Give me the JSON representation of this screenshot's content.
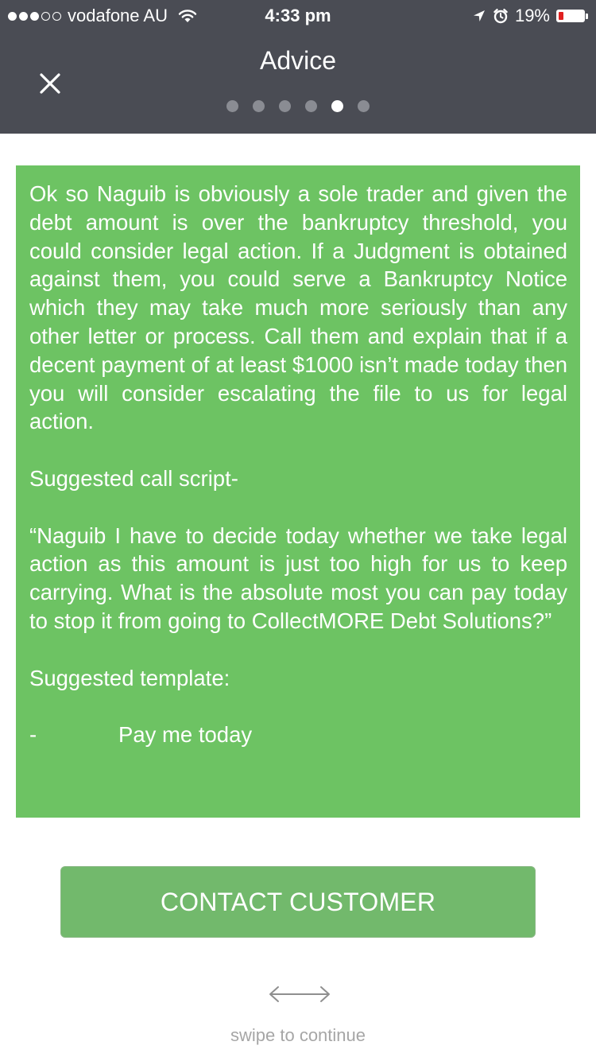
{
  "status_bar": {
    "carrier": "vodafone AU",
    "time": "4:33 pm",
    "battery_percent": "19%",
    "battery_level": 0.19,
    "signal_bars": {
      "filled": 3,
      "total": 5
    },
    "icons": [
      "wifi-icon",
      "location-arrow-icon",
      "alarm-icon",
      "battery-icon"
    ]
  },
  "nav": {
    "title": "Advice",
    "close_icon": "close-icon",
    "pager": {
      "total": 6,
      "active_index": 4
    }
  },
  "advice": {
    "paragraphs": [
      "Ok so Naguib is obviously a sole trader and given the debt amount is over the bankruptcy threshold, you could consider legal action.  If a Judgment is obtained against them, you could serve a Bankruptcy Notice which they may take much more seriously than any other letter or process.  Call them and explain that if a decent payment of at least $1000 isn’t made today then you will consider escalating the file to us for legal action.",
      "Suggested call script-",
      "“Naguib I have to decide today whether we take legal action as this amount is just too high for us to keep carrying.  What is the absolute most you can pay today to stop it from going to CollectMORE Debt Solutions?”",
      "Suggested template:"
    ],
    "template_dash": "-",
    "template_item": "Pay me today",
    "background_color": "#6dc363"
  },
  "contact_button": {
    "label": "CONTACT CUSTOMER",
    "color": "#72b96c"
  },
  "swipe": {
    "icon": "swipe-arrow-icon",
    "label": "swipe to continue"
  }
}
